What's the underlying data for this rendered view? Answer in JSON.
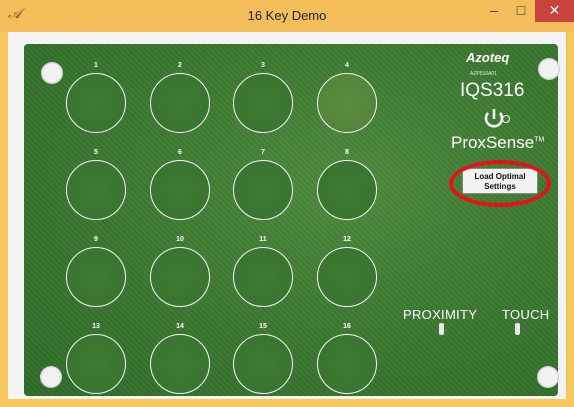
{
  "window": {
    "title": "16 Key Demo",
    "app_icon": "𝒜",
    "controls": {
      "minimize": "–",
      "maximize": "□",
      "close": "✕"
    }
  },
  "board": {
    "pads": [
      {
        "label": "1",
        "active": false
      },
      {
        "label": "2",
        "active": false
      },
      {
        "label": "3",
        "active": false
      },
      {
        "label": "4",
        "active": true
      },
      {
        "label": "5",
        "active": false
      },
      {
        "label": "6",
        "active": false
      },
      {
        "label": "7",
        "active": false
      },
      {
        "label": "8",
        "active": false
      },
      {
        "label": "9",
        "active": false
      },
      {
        "label": "10",
        "active": false
      },
      {
        "label": "11",
        "active": false
      },
      {
        "label": "12",
        "active": false
      },
      {
        "label": "13",
        "active": false
      },
      {
        "label": "14",
        "active": false
      },
      {
        "label": "15",
        "active": false
      },
      {
        "label": "16",
        "active": false
      }
    ],
    "logo": "Azoteq",
    "part_number": "AZP516A01",
    "chip": "IQS316",
    "brand": "ProxSense",
    "brand_mark": "TM",
    "load_button": {
      "line1": "Load Optimal",
      "line2": "Settings"
    },
    "proximity_label": "PROXIMITY",
    "touch_label": "TOUCH",
    "colors": {
      "board": "#3c7a31",
      "highlight_ring": "#e8101a",
      "titlebar": "#f4be5a",
      "close": "#c7433c"
    }
  }
}
